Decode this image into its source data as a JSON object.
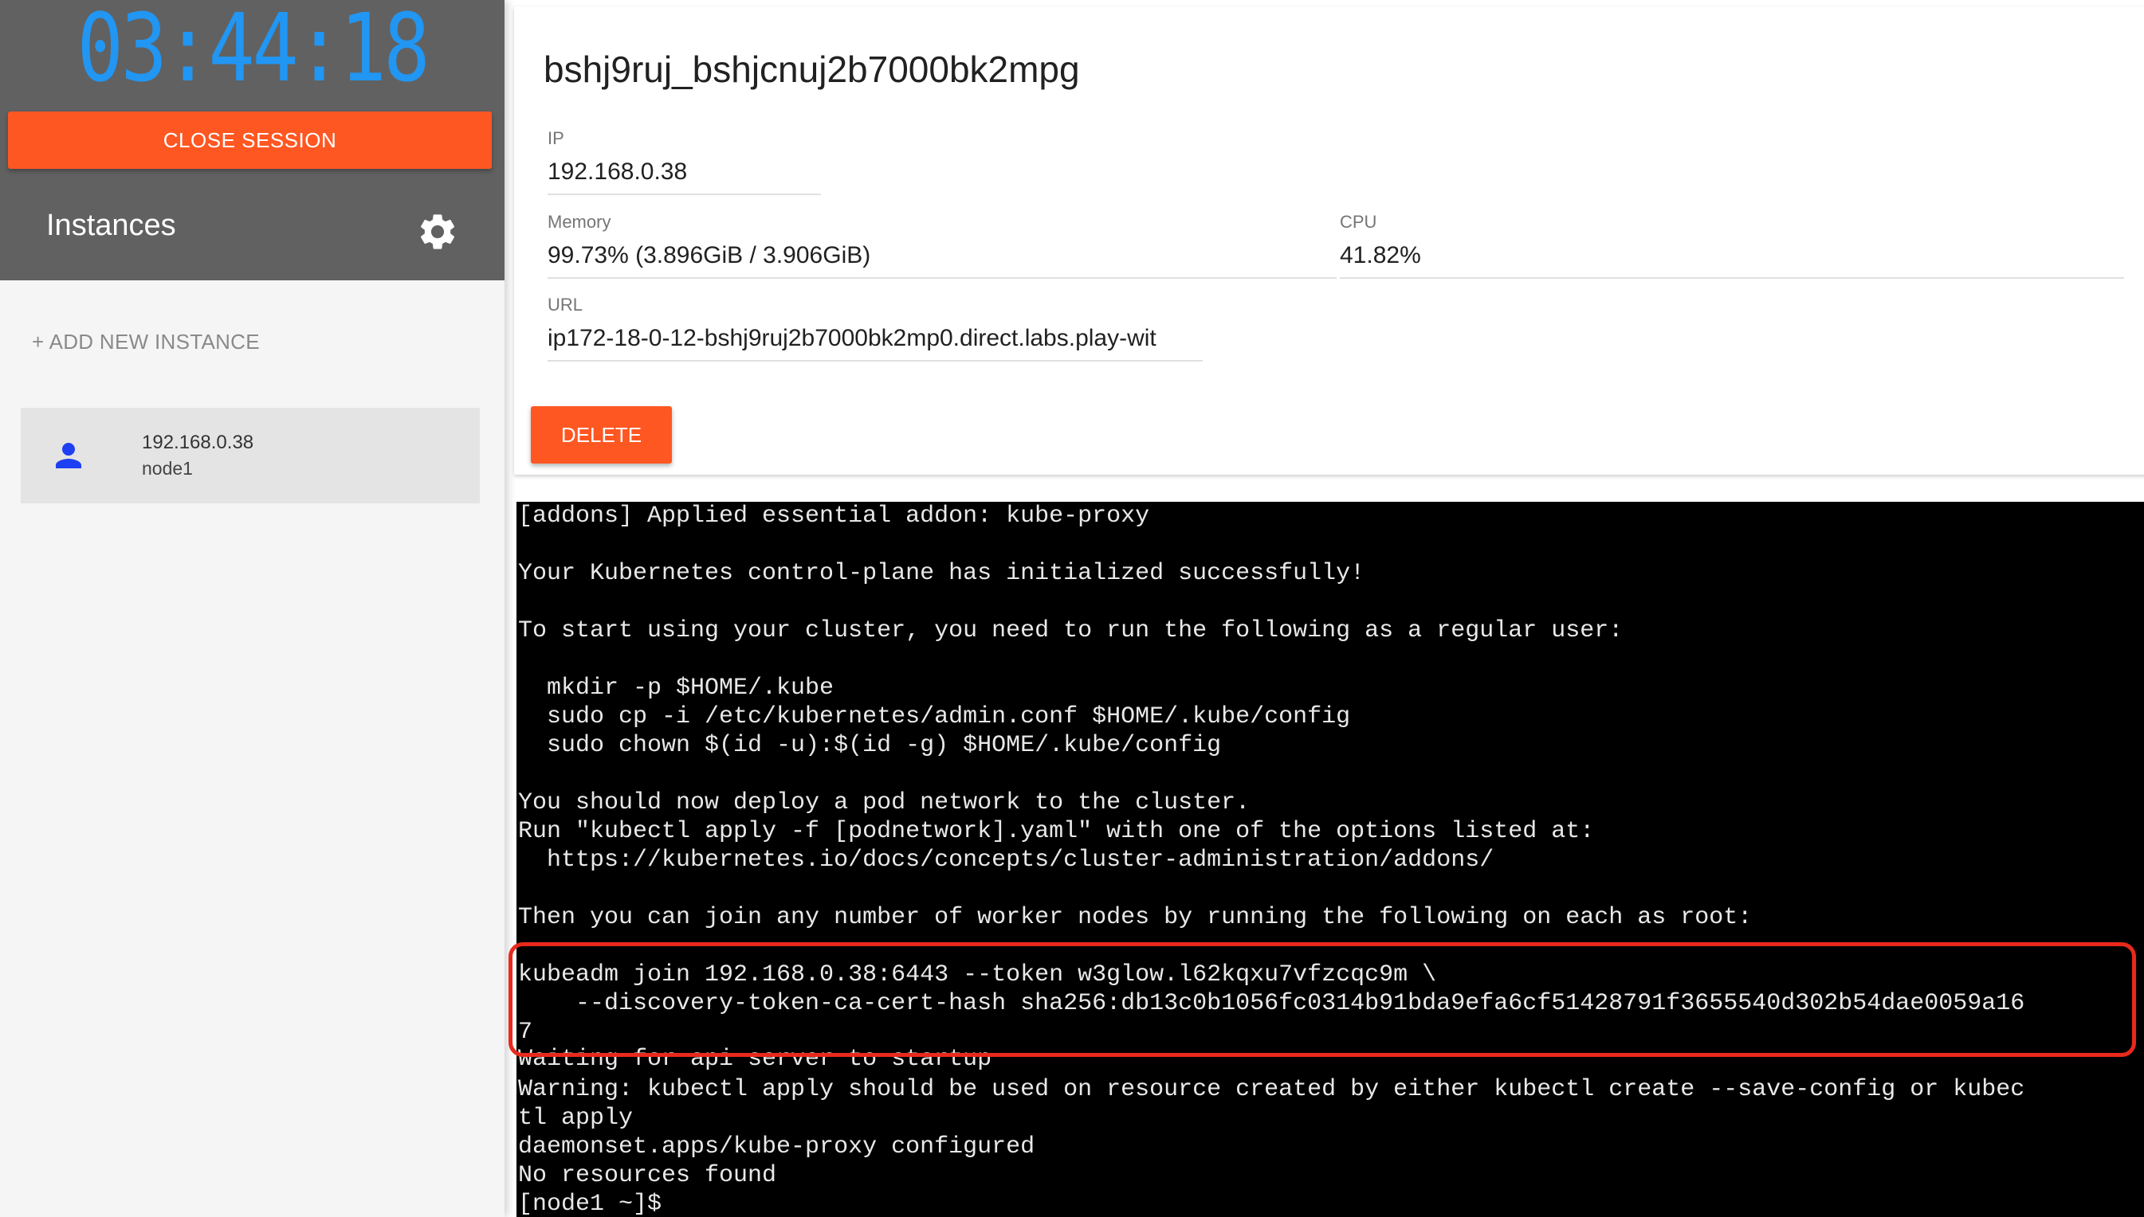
{
  "session": {
    "timer": "03:44:18",
    "close_label": "CLOSE SESSION"
  },
  "sidebar": {
    "instances_title": "Instances",
    "settings_icon": "gear-icon",
    "add_instance_label": "+ ADD NEW INSTANCE",
    "instances": [
      {
        "ip": "192.168.0.38",
        "name": "node1",
        "icon": "person-icon",
        "icon_color": "#1e3ff2"
      }
    ]
  },
  "instance": {
    "hostname": "bshj9ruj_bshjcnuj2b7000bk2mpg",
    "ip_label": "IP",
    "ip_value": "192.168.0.38",
    "memory_label": "Memory",
    "memory_value": "99.73% (3.896GiB / 3.906GiB)",
    "cpu_label": "CPU",
    "cpu_value": "41.82%",
    "url_label": "URL",
    "url_value": "ip172-18-0-12-bshj9ruj2b7000bk2mp0.direct.labs.play-wit",
    "delete_label": "DELETE"
  },
  "terminal": {
    "lines": [
      "[addons] Applied essential addon: kube-proxy",
      "",
      "Your Kubernetes control-plane has initialized successfully!",
      "",
      "To start using your cluster, you need to run the following as a regular user:",
      "",
      "  mkdir -p $HOME/.kube",
      "  sudo cp -i /etc/kubernetes/admin.conf $HOME/.kube/config",
      "  sudo chown $(id -u):$(id -g) $HOME/.kube/config",
      "",
      "You should now deploy a pod network to the cluster.",
      "Run \"kubectl apply -f [podnetwork].yaml\" with one of the options listed at:",
      "  https://kubernetes.io/docs/concepts/cluster-administration/addons/",
      "",
      "Then you can join any number of worker nodes by running the following on each as root:",
      "",
      "kubeadm join 192.168.0.38:6443 --token w3glow.l62kqxu7vfzcqc9m \\",
      "    --discovery-token-ca-cert-hash sha256:db13c0b1056fc0314b91bda9efa6cf51428791f3655540d302b54dae0059a16",
      "7",
      "Waiting for api server to startup",
      "Warning: kubectl apply should be used on resource created by either kubectl create --save-config or kubec",
      "tl apply",
      "daemonset.apps/kube-proxy configured",
      "No resources found",
      "[node1 ~]$"
    ]
  },
  "colors": {
    "accent": "#ff5722",
    "timer": "#2196f3",
    "highlight": "#e8291c"
  }
}
